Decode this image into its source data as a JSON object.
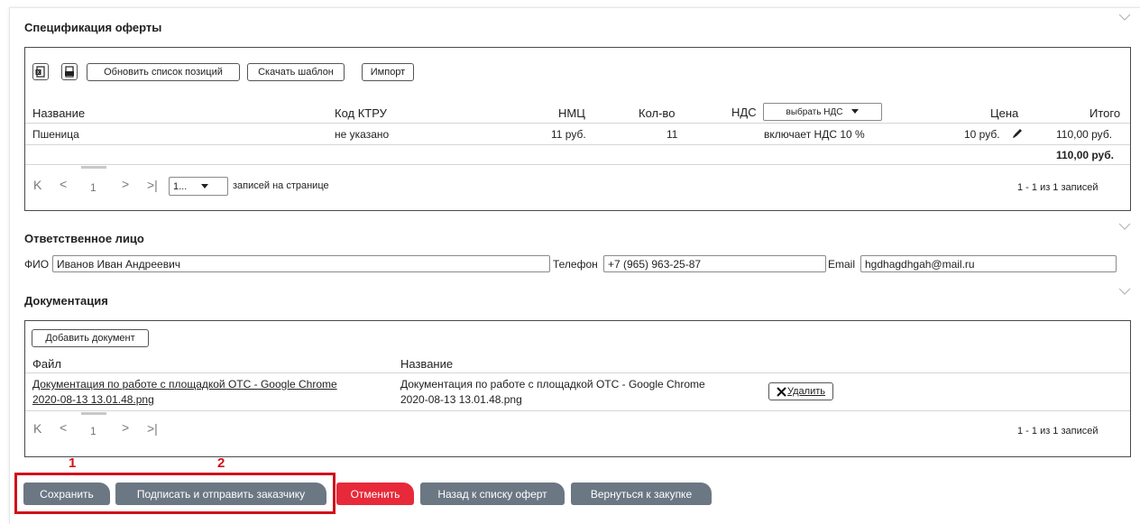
{
  "spec": {
    "title": "Спецификация оферты",
    "toolbar": {
      "update_label": "Обновить список позиций",
      "template_label": "Скачать шаблон",
      "import_label": "Импорт"
    },
    "columns": {
      "name": "Название",
      "ktru": "Код КТРУ",
      "nmc": "НМЦ",
      "qty": "Кол-во",
      "vat": "НДС",
      "vat_select": "выбрать НДС",
      "price": "Цена",
      "total": "Итого"
    },
    "rows": [
      {
        "name": "Пшеница",
        "ktru": "не указано",
        "nmc": "11 руб.",
        "qty": "11",
        "vat": "включает НДС 10 %",
        "price": "10 руб.",
        "total": "110,00 руб."
      }
    ],
    "sum_total": "110,00 руб.",
    "pager": {
      "page": "1",
      "page_size": "1...",
      "per_page_label": "записей на странице",
      "summary": "1 - 1 из 1 записей"
    }
  },
  "contact": {
    "title": "Ответственное лицо",
    "fio_label": "ФИО",
    "fio_value": "Иванов Иван Андреевич",
    "phone_label": "Телефон",
    "phone_value": "+7 (965) 963-25-87",
    "email_label": "Email",
    "email_value": "hgdhagdhgah@mail.ru"
  },
  "docs": {
    "title": "Документация",
    "add_label": "Добавить документ",
    "columns": {
      "file": "Файл",
      "name": "Название"
    },
    "rows": [
      {
        "file_line1": "Документация по работе с площадкой ОТС - Google Chrome",
        "file_line2": "2020-08-13 13.01.48.png",
        "name_line1": "Документация по работе с площадкой ОТС - Google Chrome",
        "name_line2": "2020-08-13 13.01.48.png",
        "delete_label": "Удалить"
      }
    ],
    "pager": {
      "page": "1",
      "summary": "1 - 1 из 1 записей"
    }
  },
  "actions": {
    "save_label": "Сохранить",
    "sign_label": "Подписать и отправить заказчику",
    "cancel_label": "Отменить",
    "back_label": "Назад к списку оферт",
    "return_label": "Вернуться к закупке",
    "marker1": "1",
    "marker2": "2"
  },
  "colors": {
    "action_gray": "#6c7784",
    "cancel_red": "#e8293a",
    "highlight_red": "#d0121b"
  }
}
